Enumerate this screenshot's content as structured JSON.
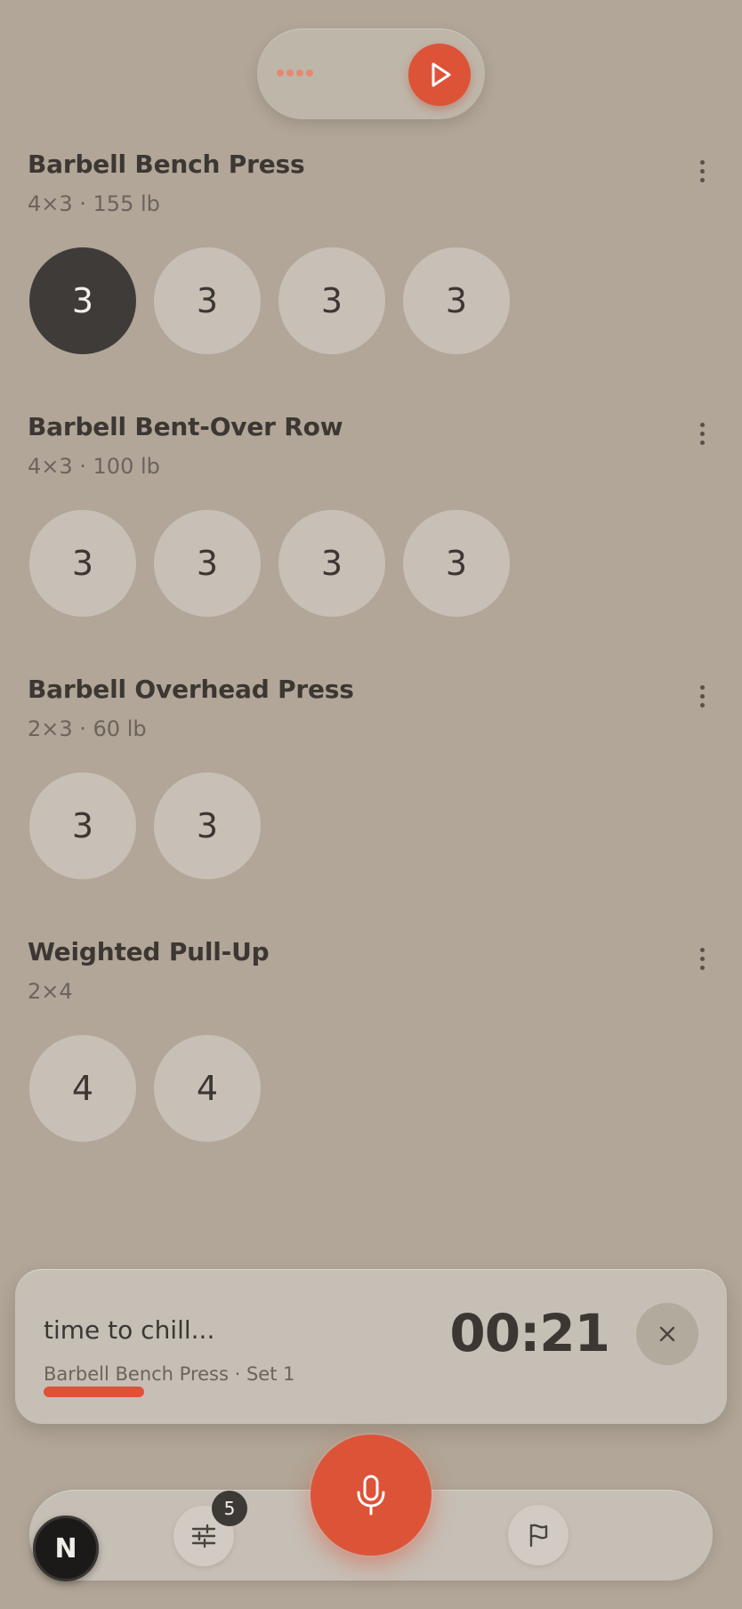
{
  "colors": {
    "background": "#b1a697",
    "accent": "#dd5338",
    "active_set": "#3f3b38",
    "set_circle": "#c8c0b7"
  },
  "top_bar": {
    "dots_icon": "dots-icon",
    "play_icon": "play-icon"
  },
  "exercises": [
    {
      "name": "Barbell Bench Press",
      "meta": "4×3 · 155 lb",
      "sets": [
        "3",
        "3",
        "3",
        "3"
      ],
      "active_index": 0
    },
    {
      "name": "Barbell Bent-Over Row",
      "meta": "4×3 · 100 lb",
      "sets": [
        "3",
        "3",
        "3",
        "3"
      ]
    },
    {
      "name": "Barbell Overhead Press",
      "meta": "2×3 · 60 lb",
      "sets": [
        "3",
        "3"
      ]
    },
    {
      "name": "Weighted Pull-Up",
      "meta": "2×4",
      "sets": [
        "4",
        "4"
      ]
    }
  ],
  "rest_timer": {
    "title": "time to chill...",
    "subtitle": "Barbell Bench Press · Set 1",
    "time": "00:21",
    "progress_fraction": 0.16
  },
  "bottom_nav": {
    "avatar_letter": "N",
    "filters_badge": "5",
    "icons": [
      "sliders-icon",
      "mic-icon",
      "flag-icon"
    ]
  }
}
